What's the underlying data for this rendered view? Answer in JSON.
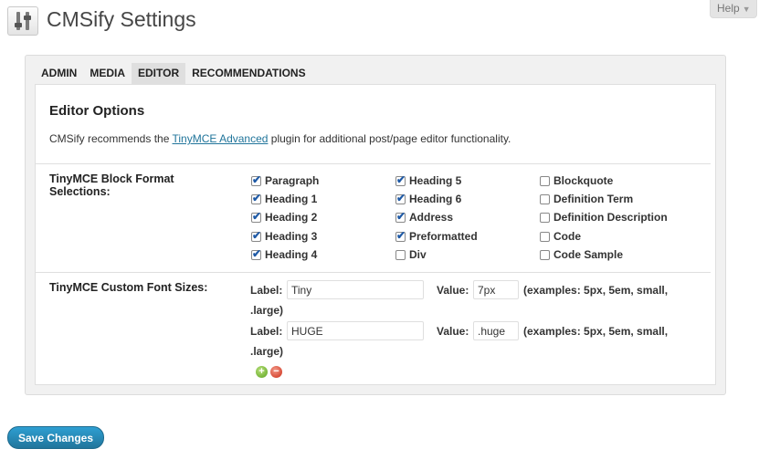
{
  "header": {
    "title": "CMSify Settings",
    "help_label": "Help"
  },
  "tabs": [
    {
      "label": "ADMIN"
    },
    {
      "label": "MEDIA"
    },
    {
      "label": "EDITOR"
    },
    {
      "label": "RECOMMENDATIONS"
    }
  ],
  "active_tab": "EDITOR",
  "editor": {
    "title": "Editor Options",
    "intro_before": "CMSify recommends the ",
    "intro_link": "TinyMCE Advanced",
    "intro_after": " plugin for additional post/page editor functionality.",
    "block_formats": {
      "label": "TinyMCE Block Format Selections:",
      "options": [
        {
          "label": "Paragraph",
          "checked": true
        },
        {
          "label": "Heading 1",
          "checked": true
        },
        {
          "label": "Heading 2",
          "checked": true
        },
        {
          "label": "Heading 3",
          "checked": true
        },
        {
          "label": "Heading 4",
          "checked": true
        },
        {
          "label": "Heading 5",
          "checked": true
        },
        {
          "label": "Heading 6",
          "checked": true
        },
        {
          "label": "Address",
          "checked": true
        },
        {
          "label": "Preformatted",
          "checked": true
        },
        {
          "label": "Div",
          "checked": false
        },
        {
          "label": "Blockquote",
          "checked": false
        },
        {
          "label": "Definition Term",
          "checked": false
        },
        {
          "label": "Definition Description",
          "checked": false
        },
        {
          "label": "Code",
          "checked": false
        },
        {
          "label": "Code Sample",
          "checked": false
        }
      ]
    },
    "font_sizes": {
      "label": "TinyMCE Custom Font Sizes:",
      "label_text": "Label:",
      "value_text": "Value:",
      "examples_line1": "(examples: 5px, 5em, small,",
      "examples_line2": ".large)",
      "rows": [
        {
          "label_value": "Tiny",
          "value_value": "7px"
        },
        {
          "label_value": "HUGE",
          "value_value": ".huge"
        }
      ]
    }
  },
  "buttons": {
    "add_symbol": "+",
    "remove_symbol": "−",
    "save_label": "Save Changes"
  },
  "colors": {
    "link": "#21759b",
    "save_button": "#21759b",
    "check": "#1f5aa6"
  }
}
